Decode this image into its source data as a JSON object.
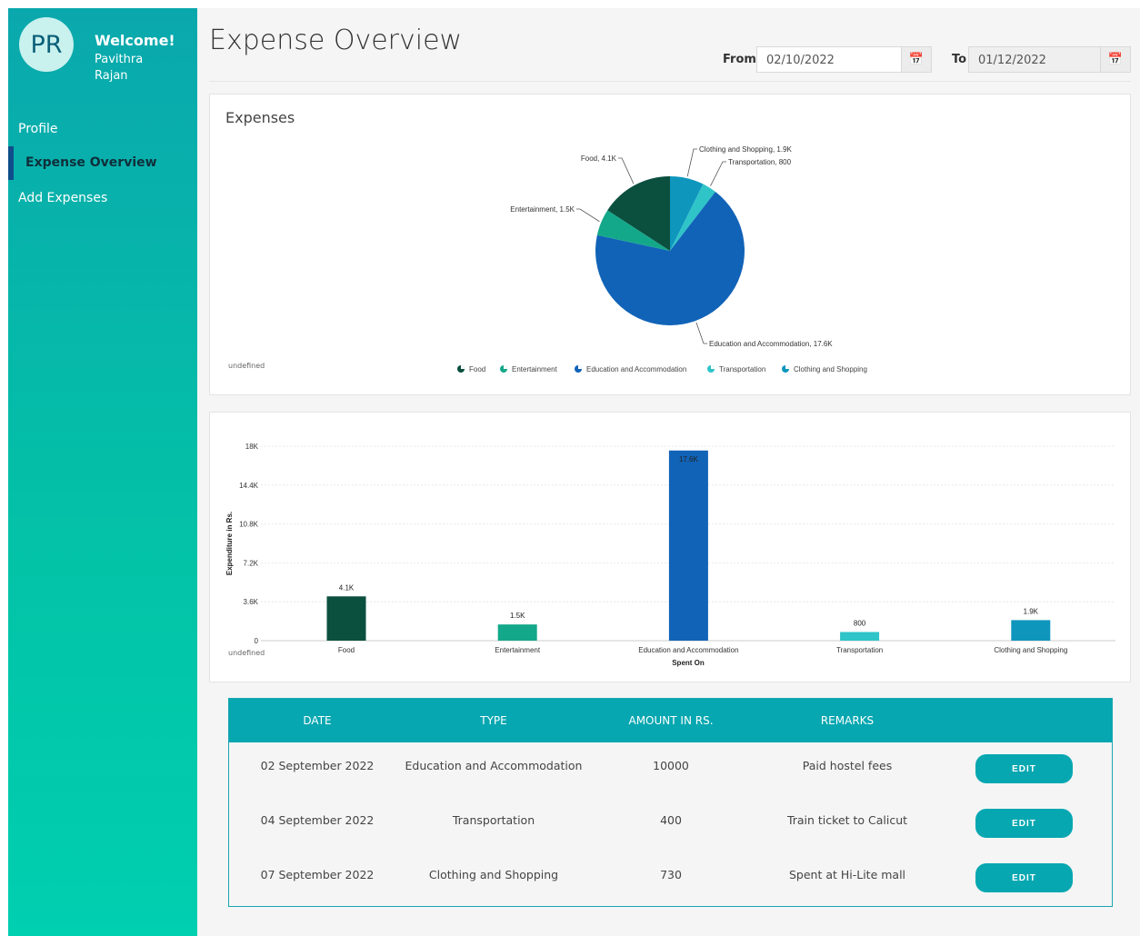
{
  "sidebar": {
    "avatar_initials": "PR",
    "welcome": "Welcome!",
    "user_name": "Pavithra Rajan",
    "items": [
      {
        "label": "Profile",
        "active": false
      },
      {
        "label": "Expense Overview",
        "active": true
      },
      {
        "label": "Add Expenses",
        "active": false
      }
    ]
  },
  "header": {
    "title": "Expense Overview",
    "from_label": "From",
    "from_value": "02/10/2022",
    "to_label": "To",
    "to_value": "01/12/2022",
    "calendar_icon": "calendar-icon"
  },
  "pie_card": {
    "title": "Expenses",
    "footer_note": "undefined"
  },
  "bar_card": {
    "footer_note": "undefined"
  },
  "chart_data": [
    {
      "type": "pie",
      "title": "Expenses",
      "categories": [
        "Food",
        "Entertainment",
        "Education and Accommodation",
        "Transportation",
        "Clothing and Shopping"
      ],
      "values": [
        4100,
        1500,
        17600,
        800,
        1900
      ],
      "slice_labels": [
        "Food, 4.1K",
        "Entertainment, 1.5K",
        "Education and Accommodation, 17.6K",
        "Transportation, 800",
        "Clothing and Shopping, 1.9K"
      ],
      "colors": [
        "#0b4f3f",
        "#14a88a",
        "#1163b7",
        "#2ec4c8",
        "#0f96bd"
      ],
      "legend": "bottom"
    },
    {
      "type": "bar",
      "categories": [
        "Food",
        "Entertainment",
        "Education and Accommodation",
        "Transportation",
        "Clothing and Shopping"
      ],
      "values": [
        4100,
        1500,
        17600,
        800,
        1900
      ],
      "data_labels": [
        "4.1K",
        "1.5K",
        "17.6K",
        "800",
        "1.9K"
      ],
      "colors": [
        "#0b4f3f",
        "#14a88a",
        "#1163b7",
        "#2ec4c8",
        "#0f96bd"
      ],
      "xlabel": "Spent On",
      "ylabel": "Expenditure in Rs.",
      "ylim": [
        0,
        18000
      ],
      "yticks": [
        0,
        3600,
        7200,
        10800,
        14400,
        18000
      ],
      "ytick_labels": [
        "0",
        "3.6K",
        "7.2K",
        "10.8K",
        "14.4K",
        "18K"
      ],
      "grid": true
    }
  ],
  "table": {
    "headers": [
      "DATE",
      "TYPE",
      "AMOUNT IN RS.",
      "REMARKS"
    ],
    "rows": [
      {
        "date": "02 September 2022",
        "type": "Education and Accommodation",
        "amount": "10000",
        "remarks": "Paid hostel fees",
        "action": "EDIT"
      },
      {
        "date": "04 September 2022",
        "type": "Transportation",
        "amount": "400",
        "remarks": "Train ticket to Calicut",
        "action": "EDIT"
      },
      {
        "date": "07 September 2022",
        "type": "Clothing and Shopping",
        "amount": "730",
        "remarks": "Spent at Hi-Lite mall",
        "action": "EDIT"
      }
    ]
  }
}
